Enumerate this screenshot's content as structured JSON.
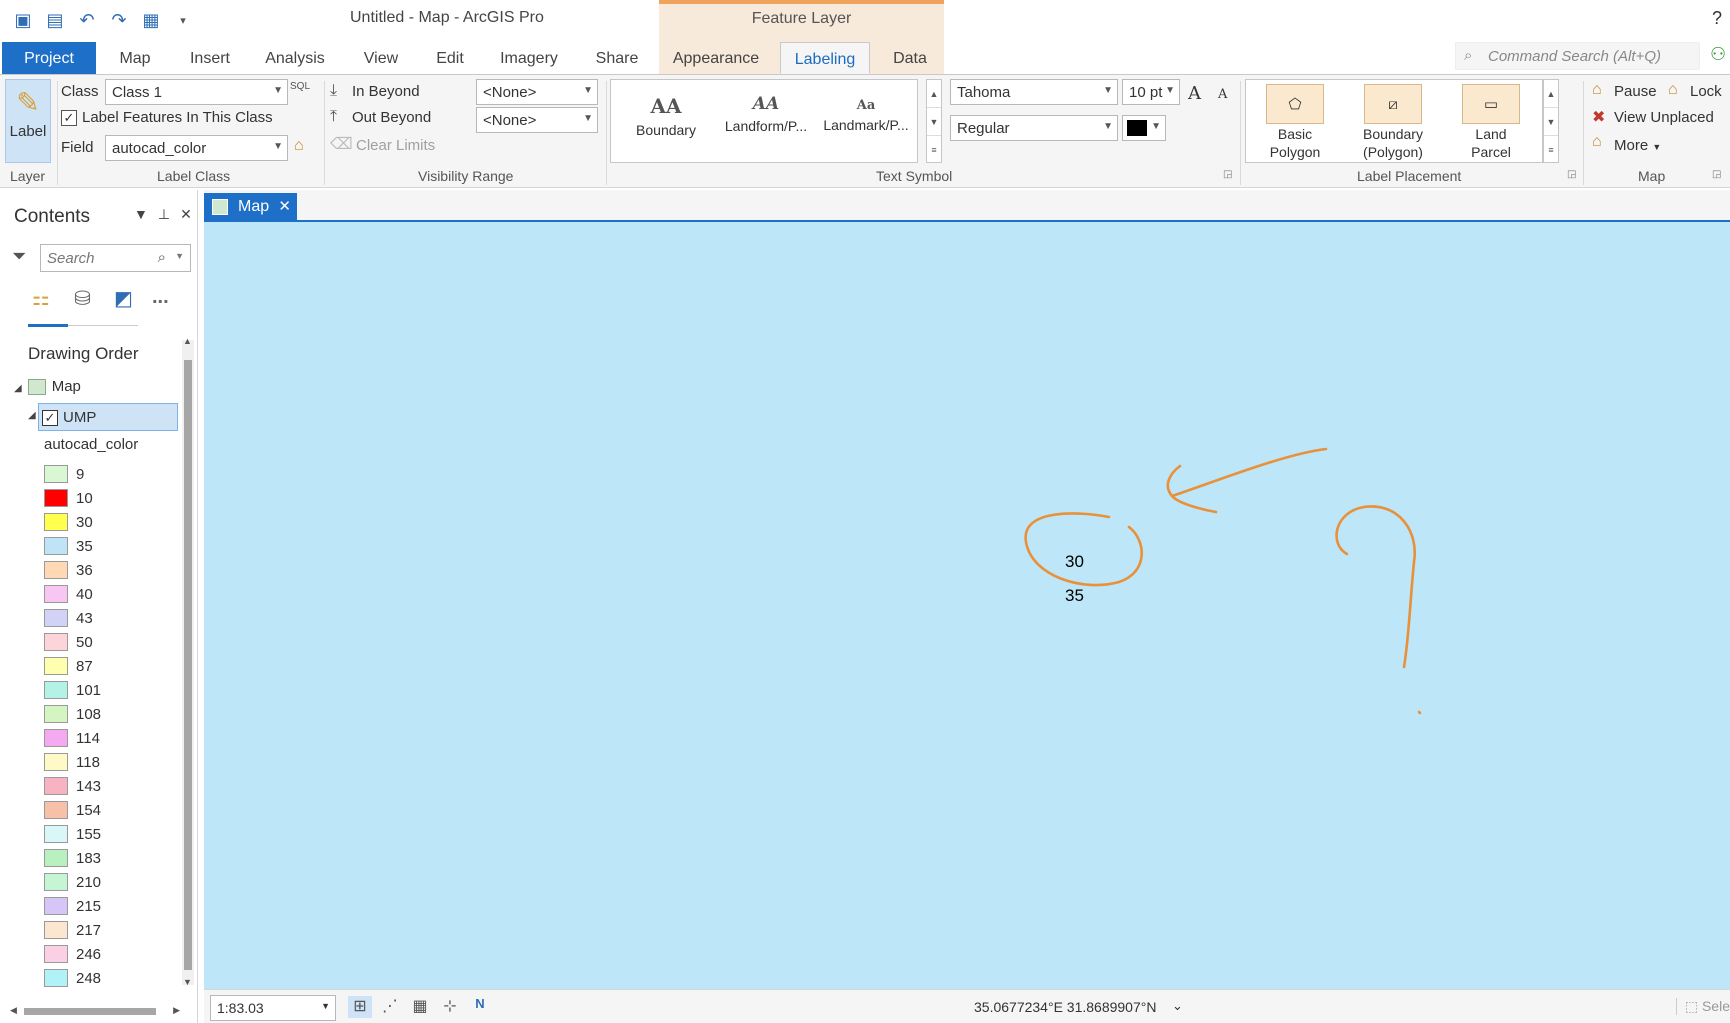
{
  "window": {
    "title": "Untitled - Map - ArcGIS Pro",
    "context_header": "Feature Layer",
    "help": "?"
  },
  "tabs": {
    "project": "Project",
    "map": "Map",
    "insert": "Insert",
    "analysis": "Analysis",
    "view": "View",
    "edit": "Edit",
    "imagery": "Imagery",
    "share": "Share",
    "appearance": "Appearance",
    "labeling": "Labeling",
    "data": "Data"
  },
  "command_search": {
    "placeholder": "Command Search (Alt+Q)"
  },
  "ribbon": {
    "layer": {
      "label_button": "Label",
      "group": "Layer"
    },
    "label_class": {
      "class_label": "Class",
      "class_value": "Class 1",
      "label_features_checkbox": "Label Features In This Class",
      "field_label": "Field",
      "field_value": "autocad_color",
      "sql_badge": "SQL",
      "group": "Label Class"
    },
    "visibility": {
      "in_beyond": "In Beyond",
      "out_beyond": "Out Beyond",
      "clear_limits": "Clear Limits",
      "in_value": "<None>",
      "out_value": "<None>",
      "group": "Visibility Range"
    },
    "text_symbol": {
      "items": [
        {
          "glyph": "AA",
          "label": "Boundary"
        },
        {
          "glyph": "AA",
          "label": "Landform/P..."
        },
        {
          "glyph": "Aa",
          "label": "Landmark/P..."
        }
      ],
      "font": "Tahoma",
      "size": "10 pt",
      "style": "Regular",
      "grow": "A",
      "shrink": "A",
      "color": "#000000",
      "group": "Text Symbol"
    },
    "label_placement": {
      "items": [
        {
          "label_1": "Basic",
          "label_2": "Polygon"
        },
        {
          "label_1": "Boundary",
          "label_2": "(Polygon)"
        },
        {
          "label_1": "Land",
          "label_2": "Parcel"
        }
      ],
      "group": "Label Placement"
    },
    "map_group": {
      "pause": "Pause",
      "lock": "Lock",
      "view_unplaced": "View Unplaced",
      "more": "More",
      "group": "Map"
    }
  },
  "contents": {
    "title": "Contents",
    "search_placeholder": "Search",
    "more_dots": "...",
    "drawing_order": "Drawing Order",
    "map_node": "Map",
    "layer_node": "UMP",
    "field": "autocad_color",
    "legend": [
      {
        "value": "9",
        "color": "#d9f7d2"
      },
      {
        "value": "10",
        "color": "#ff0000"
      },
      {
        "value": "30",
        "color": "#ffff4d"
      },
      {
        "value": "35",
        "color": "#bfe3f7"
      },
      {
        "value": "36",
        "color": "#ffd9b3"
      },
      {
        "value": "40",
        "color": "#f7c6f2"
      },
      {
        "value": "43",
        "color": "#d2d2f7"
      },
      {
        "value": "50",
        "color": "#fcd4da"
      },
      {
        "value": "87",
        "color": "#ffffb0"
      },
      {
        "value": "101",
        "color": "#b3f2e4"
      },
      {
        "value": "108",
        "color": "#d4f5c2"
      },
      {
        "value": "114",
        "color": "#f5a9f0"
      },
      {
        "value": "118",
        "color": "#fff9c8"
      },
      {
        "value": "143",
        "color": "#f7b3c2"
      },
      {
        "value": "154",
        "color": "#f7c0a8"
      },
      {
        "value": "155",
        "color": "#d9f7f7"
      },
      {
        "value": "183",
        "color": "#b8f0c0"
      },
      {
        "value": "210",
        "color": "#c6f5d4"
      },
      {
        "value": "215",
        "color": "#d6c6f7"
      },
      {
        "value": "217",
        "color": "#fde6d0"
      },
      {
        "value": "246",
        "color": "#fcd0e4"
      },
      {
        "value": "248",
        "color": "#b0f2f7"
      }
    ]
  },
  "map_view": {
    "tab": "Map",
    "close": "✕",
    "labels": [
      "30",
      "35"
    ],
    "background": "#bde6f8",
    "annotation_color": "#e8913a"
  },
  "status": {
    "scale": "1:83.03",
    "coordinates": "35.0677234°E 31.8689907°N",
    "selected": "Sele"
  }
}
